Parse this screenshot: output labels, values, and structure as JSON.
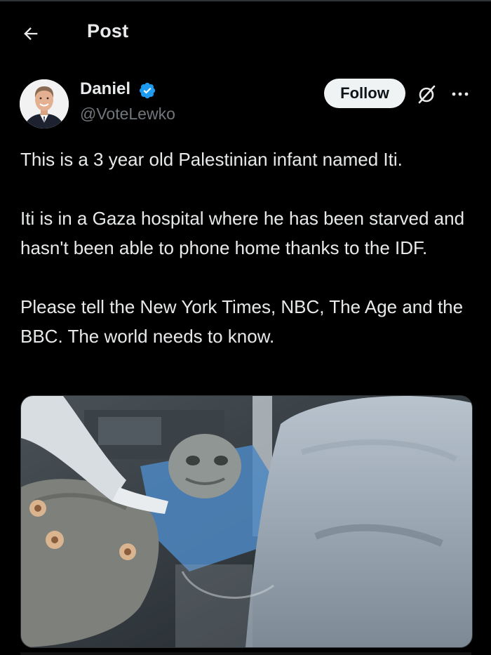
{
  "topbar": {
    "title": "Post",
    "back_icon": "arrow-left-icon"
  },
  "author": {
    "name": "Daniel",
    "handle": "@VoteLewko",
    "verified": true,
    "verified_color": "#1d9bf0"
  },
  "actions": {
    "follow_label": "Follow",
    "grok_icon": "grok-icon",
    "more_icon": "more-horizontal-icon"
  },
  "post": {
    "paragraphs": [
      "This is a 3 year old Palestinian infant named Iti.",
      "Iti is in a Gaza hospital where he has been starved and hasn't been able to phone home thanks to the IDF.",
      "Please tell the New York Times, NBC, The Age and the BBC. The world needs to know."
    ]
  },
  "colors": {
    "background": "#000000",
    "text_primary": "#e7e9ea",
    "text_secondary": "#71767b",
    "follow_bg": "#eff3f4"
  }
}
